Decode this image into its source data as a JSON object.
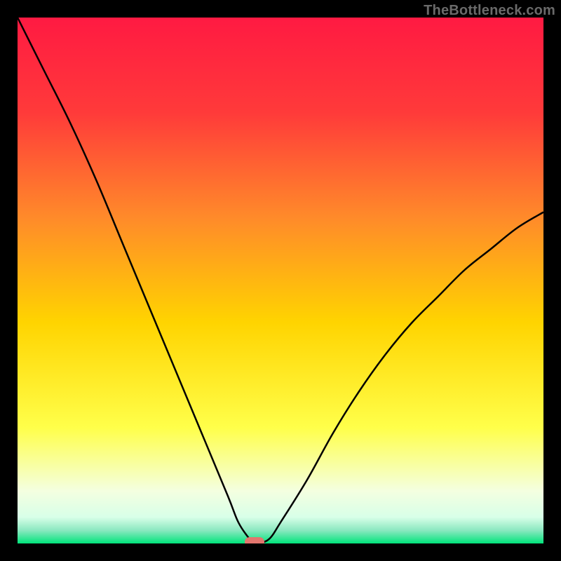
{
  "watermark": "TheBottleneck.com",
  "colors": {
    "gradient_top": "#ff1a42",
    "gradient_upper": "#ff6b2e",
    "gradient_mid": "#ffd400",
    "gradient_lower": "#ffff8a",
    "gradient_pale": "#f4ffe0",
    "gradient_teal": "#8be8c0",
    "gradient_bottom": "#00e47b",
    "curve": "#000000",
    "marker": "#e2766e",
    "frame": "#000000"
  },
  "chart_data": {
    "type": "line",
    "title": "",
    "xlabel": "",
    "ylabel": "",
    "xlim": [
      0,
      100
    ],
    "ylim": [
      0,
      100
    ],
    "optimum_x": 45,
    "x": [
      0,
      5,
      10,
      15,
      20,
      25,
      30,
      35,
      40,
      42,
      44,
      45,
      46,
      48,
      50,
      55,
      60,
      65,
      70,
      75,
      80,
      85,
      90,
      95,
      100
    ],
    "values": [
      100,
      90,
      80,
      69,
      57,
      45,
      33,
      21,
      9,
      4,
      1,
      0,
      0,
      1,
      4,
      12,
      21,
      29,
      36,
      42,
      47,
      52,
      56,
      60,
      63
    ],
    "series": [
      {
        "name": "bottleneck-curve",
        "x": [
          0,
          5,
          10,
          15,
          20,
          25,
          30,
          35,
          40,
          42,
          44,
          45,
          46,
          48,
          50,
          55,
          60,
          65,
          70,
          75,
          80,
          85,
          90,
          95,
          100
        ],
        "y": [
          100,
          90,
          80,
          69,
          57,
          45,
          33,
          21,
          9,
          4,
          1,
          0,
          0,
          1,
          4,
          12,
          21,
          29,
          36,
          42,
          47,
          52,
          56,
          60,
          63
        ]
      }
    ],
    "marker": {
      "x": 45,
      "y": 0
    }
  }
}
